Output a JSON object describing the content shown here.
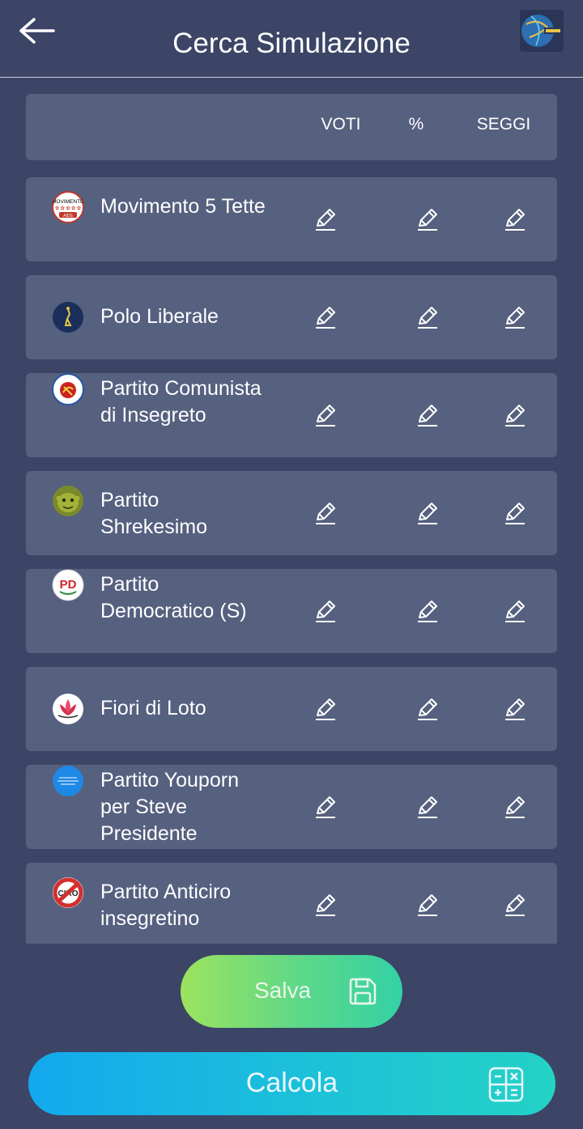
{
  "header": {
    "title": "Cerca Simulazione"
  },
  "table": {
    "columns": [
      "VOTI",
      "%",
      "SEGGI"
    ]
  },
  "parties": [
    {
      "name": "Movimento 5 Tette",
      "logo_text": "MOVIMENTO",
      "logo_text_2": "AIDS",
      "logo_icon": "movimento-5-tette-logo-icon"
    },
    {
      "name": "Polo Liberale",
      "logo_text": "",
      "logo_icon": "polo-liberale-logo-icon"
    },
    {
      "name": "Partito Comunista di Insegreto",
      "logo_text": "",
      "logo_icon": "partito-comunista-logo-icon"
    },
    {
      "name": "Partito Shrekesimo",
      "logo_text": "",
      "logo_icon": "shrek-logo-icon"
    },
    {
      "name": "Partito Democratico (S)",
      "logo_text": "PD",
      "logo_icon": "pd-logo-icon"
    },
    {
      "name": "Fiori di Loto",
      "logo_text": "",
      "logo_icon": "lotus-logo-icon"
    },
    {
      "name": "Partito Youporn per Steve Presidente",
      "logo_text": "",
      "logo_icon": "youporn-logo-icon"
    },
    {
      "name": "Partito Anticiro insegretino",
      "logo_text": "CIRO",
      "logo_icon": "no-ciro-logo-icon"
    }
  ],
  "actions": {
    "save_label": "Salva",
    "calc_label": "Calcola"
  },
  "colors": {
    "background": "#3c4566",
    "card": "#56607f",
    "save_gradient": [
      "#9de35e",
      "#33d1a6"
    ],
    "calc_gradient": [
      "#14a8ee",
      "#24d2c6"
    ]
  }
}
